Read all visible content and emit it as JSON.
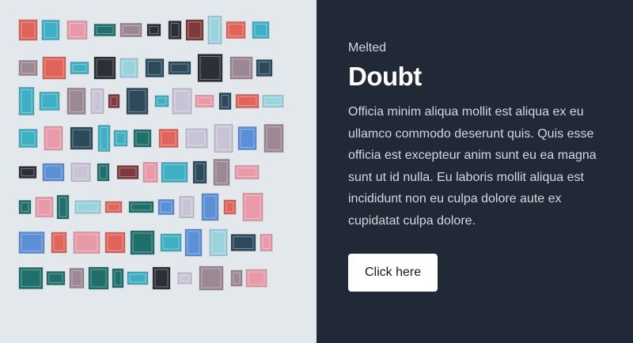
{
  "image": {
    "alt": "Wall of colorful picture frames"
  },
  "card": {
    "eyebrow": "Melted",
    "title": "Doubt",
    "body": "Officia minim aliqua mollit est aliqua ex eu ullamco commodo deserunt quis. Quis esse officia est excepteur anim sunt eu ea magna sunt ut id nulla. Eu laboris mollit aliqua est incididunt non eu culpa dolore aute ex cupidatat culpa dolore.",
    "cta_label": "Click here"
  },
  "colors": {
    "panel_bg": "#212937",
    "image_bg": "#e3e8ec",
    "button_bg": "#ffffff",
    "frame_palette": [
      "#3fb0c4",
      "#e0645a",
      "#2d4a5c",
      "#e89aa8",
      "#9ad3dc",
      "#1f6f6c",
      "#9c8794",
      "#7e3a3a",
      "#5b8fd6",
      "#c9c3d6",
      "#2c2f36"
    ]
  }
}
